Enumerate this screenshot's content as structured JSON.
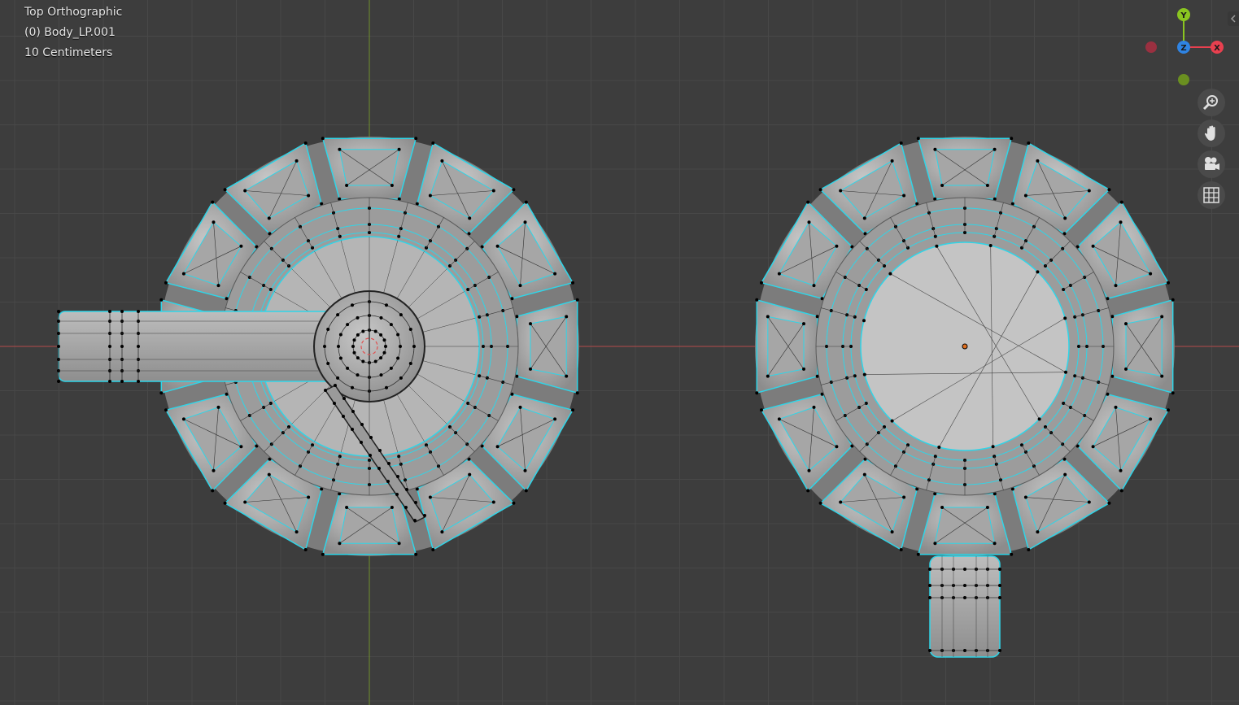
{
  "viewport": {
    "view_name": "Top Orthographic",
    "object_name": "(0) Body_LP.001",
    "grid_scale": "10 Centimeters"
  },
  "gizmo": {
    "x_label": "X",
    "y_label": "Y",
    "z_label": "Z",
    "x_color": "#e8404f",
    "y_color": "#8ac520",
    "z_color": "#2f84e3",
    "neg_x_color": "#9a3040",
    "neg_y_color": "#6a8f20"
  },
  "nav_tools": [
    {
      "name": "zoom-icon"
    },
    {
      "name": "pan-hand-icon"
    },
    {
      "name": "camera-icon"
    },
    {
      "name": "perspective-grid-icon"
    }
  ],
  "colors": {
    "background": "#3d3d3d",
    "grid_line": "#484848",
    "axis_x": "#b54a4a",
    "axis_y": "#6f8f2d",
    "mesh_fill": "#a9a9a9",
    "mesh_edge": "#2fd5e8",
    "vertex": "#000000"
  }
}
